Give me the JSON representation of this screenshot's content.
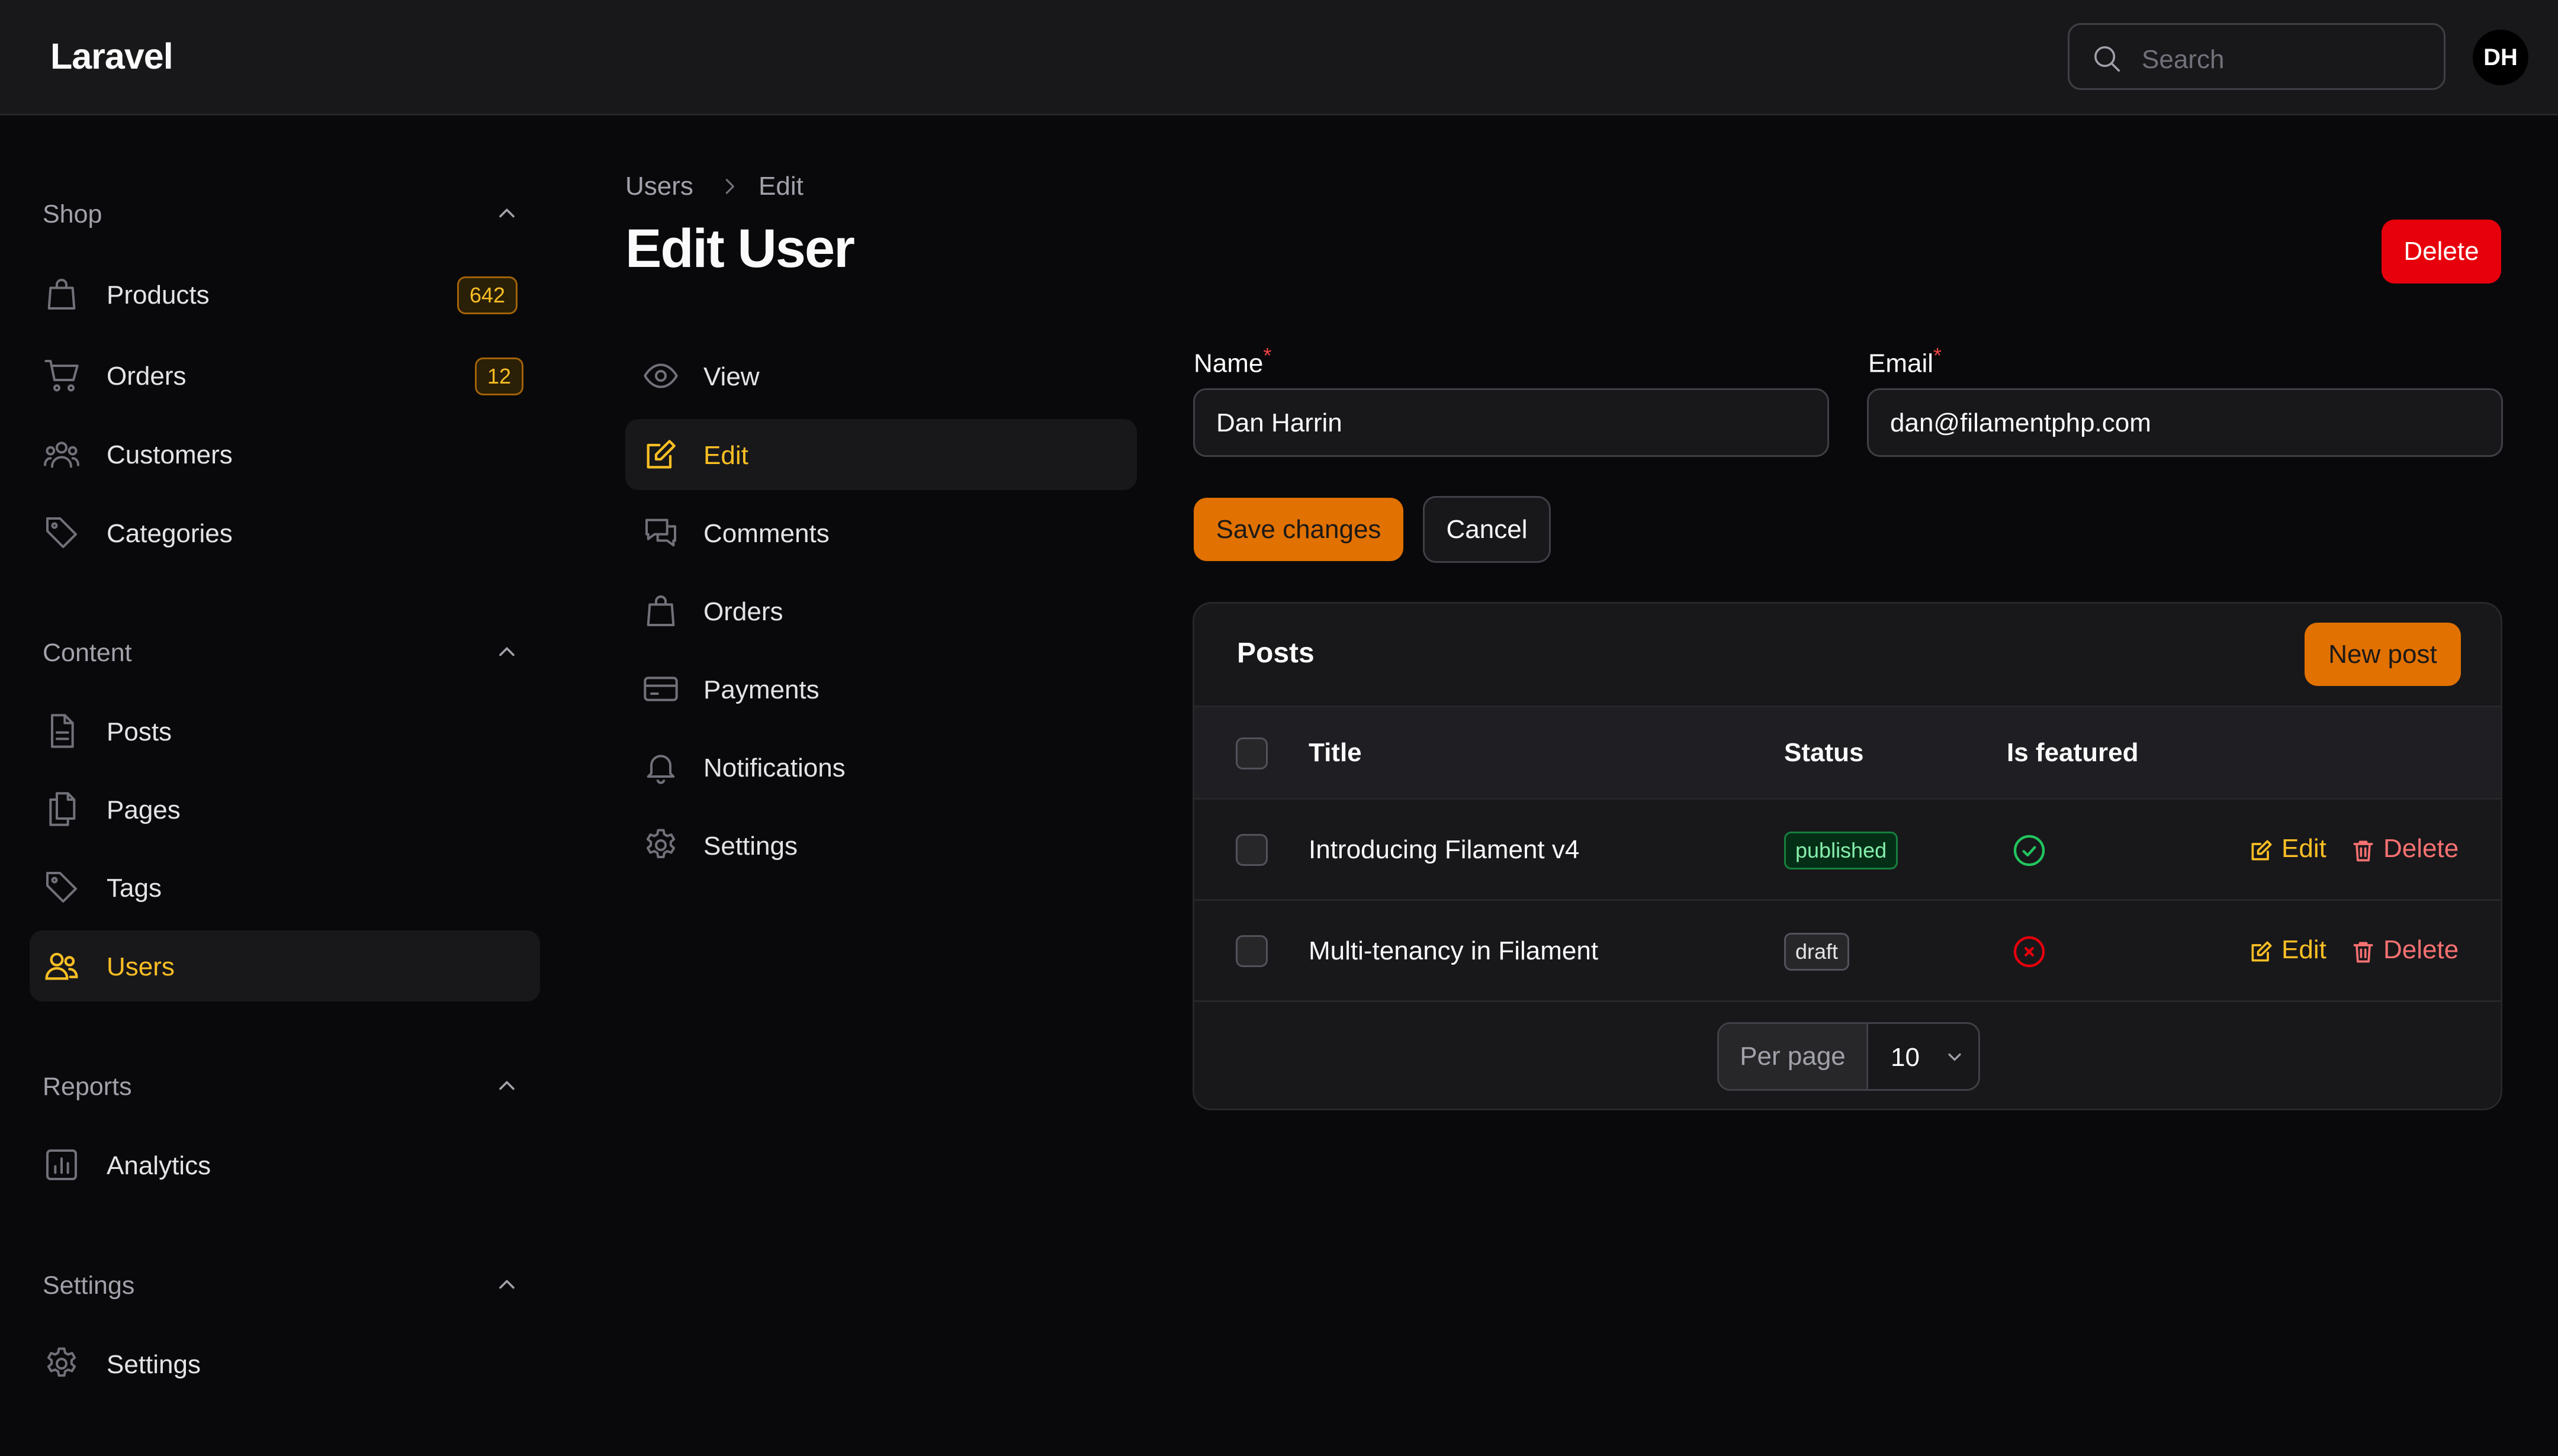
{
  "app": {
    "brand": "Laravel"
  },
  "topbar": {
    "search_placeholder": "Search",
    "avatar_initials": "DH"
  },
  "sidebar": {
    "groups": [
      {
        "label": "Shop",
        "items": [
          {
            "label": "Products",
            "icon": "shopping-bag-icon",
            "badge": "642"
          },
          {
            "label": "Orders",
            "icon": "shopping-cart-icon",
            "badge": "12"
          },
          {
            "label": "Customers",
            "icon": "user-group-icon"
          },
          {
            "label": "Categories",
            "icon": "tag-icon"
          }
        ]
      },
      {
        "label": "Content",
        "items": [
          {
            "label": "Posts",
            "icon": "document-icon"
          },
          {
            "label": "Pages",
            "icon": "documents-icon"
          },
          {
            "label": "Tags",
            "icon": "tag-icon"
          },
          {
            "label": "Users",
            "icon": "users-icon",
            "active": true
          }
        ]
      },
      {
        "label": "Reports",
        "items": [
          {
            "label": "Analytics",
            "icon": "chart-bar-icon"
          }
        ]
      },
      {
        "label": "Settings",
        "items": [
          {
            "label": "Settings",
            "icon": "cog-icon"
          }
        ]
      }
    ]
  },
  "breadcrumb": {
    "parent": "Users",
    "current": "Edit"
  },
  "page": {
    "title": "Edit User",
    "delete_label": "Delete"
  },
  "subnav": {
    "items": [
      {
        "label": "View",
        "icon": "eye-icon"
      },
      {
        "label": "Edit",
        "icon": "pencil-square-icon",
        "active": true
      },
      {
        "label": "Comments",
        "icon": "chat-bubbles-icon"
      },
      {
        "label": "Orders",
        "icon": "shopping-bag-icon"
      },
      {
        "label": "Payments",
        "icon": "credit-card-icon"
      },
      {
        "label": "Notifications",
        "icon": "bell-icon"
      },
      {
        "label": "Settings",
        "icon": "cog-icon"
      }
    ]
  },
  "form": {
    "name_label": "Name",
    "name_value": "Dan Harrin",
    "email_label": "Email",
    "email_value": "dan@filamentphp.com",
    "required_marker": "*",
    "save_label": "Save changes",
    "cancel_label": "Cancel"
  },
  "posts": {
    "title": "Posts",
    "new_label": "New post",
    "columns": [
      "Title",
      "Status",
      "Is featured"
    ],
    "rows": [
      {
        "title": "Introducing Filament v4",
        "status": "published",
        "featured": true,
        "edit": "Edit",
        "delete": "Delete"
      },
      {
        "title": "Multi-tenancy in Filament",
        "status": "draft",
        "featured": false,
        "edit": "Edit",
        "delete": "Delete"
      }
    ],
    "per_page_label": "Per page",
    "per_page_value": "10"
  },
  "colors": {
    "accent": "#fbbf24",
    "primary_button": "#e17100",
    "danger": "#e7000b",
    "success": "#22c55e",
    "background": "#09090b",
    "surface": "#18181b"
  }
}
